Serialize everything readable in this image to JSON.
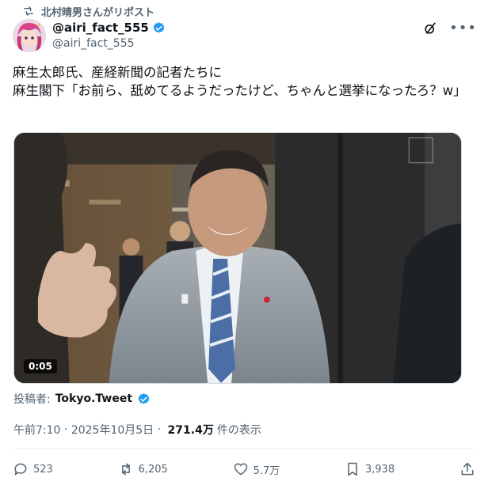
{
  "repost": {
    "label": "北村晴男さんがリポスト"
  },
  "author": {
    "display_name": "@airi_fact_555",
    "handle": "@airi_fact_555",
    "verified_color": "#1d9bf0"
  },
  "tweet": {
    "text": "麻生太郎氏、産経新聞の記者たちに\n麻生閣下「お前ら、舐めてるようだったけど、ちゃんと選挙になったろ？w」"
  },
  "media": {
    "duration": "0:05"
  },
  "source": {
    "label": "投稿者:",
    "name": "Tokyo.Tweet"
  },
  "meta": {
    "time": "午前7:10",
    "separator": " · ",
    "date": "2025年10月5日",
    "dot": " · ",
    "views": "271.4万",
    "views_label": "件の表示"
  },
  "actions": {
    "reply": {
      "icon": "reply-icon",
      "count": "523"
    },
    "retweet": {
      "icon": "retweet-icon",
      "count": "6,205"
    },
    "like": {
      "icon": "heart-icon",
      "count": "5.7万"
    },
    "bookmark": {
      "icon": "bookmark-icon",
      "count": "3,938"
    },
    "share": {
      "icon": "share-icon"
    }
  }
}
